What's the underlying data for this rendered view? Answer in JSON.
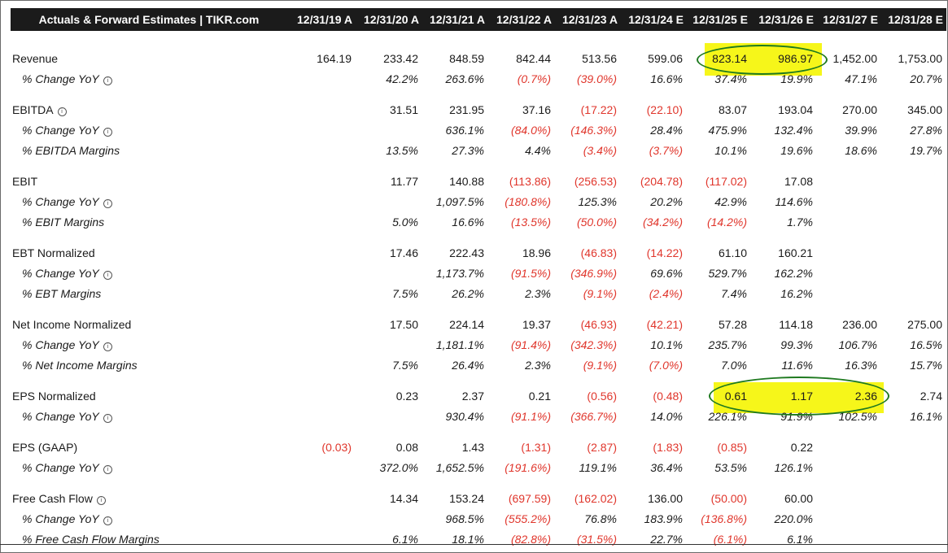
{
  "header": {
    "title": "Actuals & Forward Estimates | TIKR.com",
    "columns": [
      "12/31/19 A",
      "12/31/20 A",
      "12/31/21 A",
      "12/31/22 A",
      "12/31/23 A",
      "12/31/24 E",
      "12/31/25 E",
      "12/31/26 E",
      "12/31/27 E",
      "12/31/28 E"
    ]
  },
  "rows": [
    {
      "label": "Revenue",
      "sub": false,
      "info": false,
      "values": [
        "164.19",
        "233.42",
        "848.59",
        "842.44",
        "513.56",
        "599.06",
        "823.14",
        "986.97",
        "1,452.00",
        "1,753.00"
      ]
    },
    {
      "label": "% Change YoY",
      "sub": true,
      "info": true,
      "values": [
        "",
        "42.2%",
        "263.6%",
        "(0.7%)",
        "(39.0%)",
        "16.6%",
        "37.4%",
        "19.9%",
        "47.1%",
        "20.7%"
      ]
    },
    {
      "label": "EBITDA",
      "sub": false,
      "info": true,
      "values": [
        "",
        "31.51",
        "231.95",
        "37.16",
        "(17.22)",
        "(22.10)",
        "83.07",
        "193.04",
        "270.00",
        "345.00"
      ]
    },
    {
      "label": "% Change YoY",
      "sub": true,
      "info": true,
      "values": [
        "",
        "",
        "636.1%",
        "(84.0%)",
        "(146.3%)",
        "28.4%",
        "475.9%",
        "132.4%",
        "39.9%",
        "27.8%"
      ]
    },
    {
      "label": "% EBITDA Margins",
      "sub": true,
      "info": false,
      "values": [
        "",
        "13.5%",
        "27.3%",
        "4.4%",
        "(3.4%)",
        "(3.7%)",
        "10.1%",
        "19.6%",
        "18.6%",
        "19.7%"
      ]
    },
    {
      "label": "EBIT",
      "sub": false,
      "info": false,
      "values": [
        "",
        "11.77",
        "140.88",
        "(113.86)",
        "(256.53)",
        "(204.78)",
        "(117.02)",
        "17.08",
        "",
        ""
      ]
    },
    {
      "label": "% Change YoY",
      "sub": true,
      "info": true,
      "values": [
        "",
        "",
        "1,097.5%",
        "(180.8%)",
        "125.3%",
        "20.2%",
        "42.9%",
        "114.6%",
        "",
        ""
      ]
    },
    {
      "label": "% EBIT Margins",
      "sub": true,
      "info": false,
      "values": [
        "",
        "5.0%",
        "16.6%",
        "(13.5%)",
        "(50.0%)",
        "(34.2%)",
        "(14.2%)",
        "1.7%",
        "",
        ""
      ]
    },
    {
      "label": "EBT Normalized",
      "sub": false,
      "info": false,
      "values": [
        "",
        "17.46",
        "222.43",
        "18.96",
        "(46.83)",
        "(14.22)",
        "61.10",
        "160.21",
        "",
        ""
      ]
    },
    {
      "label": "% Change YoY",
      "sub": true,
      "info": true,
      "values": [
        "",
        "",
        "1,173.7%",
        "(91.5%)",
        "(346.9%)",
        "69.6%",
        "529.7%",
        "162.2%",
        "",
        ""
      ]
    },
    {
      "label": "% EBT Margins",
      "sub": true,
      "info": false,
      "values": [
        "",
        "7.5%",
        "26.2%",
        "2.3%",
        "(9.1%)",
        "(2.4%)",
        "7.4%",
        "16.2%",
        "",
        ""
      ]
    },
    {
      "label": "Net Income Normalized",
      "sub": false,
      "info": false,
      "values": [
        "",
        "17.50",
        "224.14",
        "19.37",
        "(46.93)",
        "(42.21)",
        "57.28",
        "114.18",
        "236.00",
        "275.00"
      ]
    },
    {
      "label": "% Change YoY",
      "sub": true,
      "info": true,
      "values": [
        "",
        "",
        "1,181.1%",
        "(91.4%)",
        "(342.3%)",
        "10.1%",
        "235.7%",
        "99.3%",
        "106.7%",
        "16.5%"
      ]
    },
    {
      "label": "% Net Income Margins",
      "sub": true,
      "info": false,
      "values": [
        "",
        "7.5%",
        "26.4%",
        "2.3%",
        "(9.1%)",
        "(7.0%)",
        "7.0%",
        "11.6%",
        "16.3%",
        "15.7%"
      ]
    },
    {
      "label": "EPS Normalized",
      "sub": false,
      "info": false,
      "values": [
        "",
        "0.23",
        "2.37",
        "0.21",
        "(0.56)",
        "(0.48)",
        "0.61",
        "1.17",
        "2.36",
        "2.74"
      ]
    },
    {
      "label": "% Change YoY",
      "sub": true,
      "info": true,
      "values": [
        "",
        "",
        "930.4%",
        "(91.1%)",
        "(366.7%)",
        "14.0%",
        "226.1%",
        "91.9%",
        "102.5%",
        "16.1%"
      ]
    },
    {
      "label": "EPS (GAAP)",
      "sub": false,
      "info": false,
      "values": [
        "(0.03)",
        "0.08",
        "1.43",
        "(1.31)",
        "(2.87)",
        "(1.83)",
        "(0.85)",
        "0.22",
        "",
        ""
      ]
    },
    {
      "label": "% Change YoY",
      "sub": true,
      "info": true,
      "values": [
        "",
        "372.0%",
        "1,652.5%",
        "(191.6%)",
        "119.1%",
        "36.4%",
        "53.5%",
        "126.1%",
        "",
        ""
      ]
    },
    {
      "label": "Free Cash Flow",
      "sub": false,
      "info": true,
      "values": [
        "",
        "14.34",
        "153.24",
        "(697.59)",
        "(162.02)",
        "136.00",
        "(50.00)",
        "60.00",
        "",
        ""
      ]
    },
    {
      "label": "% Change YoY",
      "sub": true,
      "info": true,
      "values": [
        "",
        "",
        "968.5%",
        "(555.2%)",
        "76.8%",
        "183.9%",
        "(136.8%)",
        "220.0%",
        "",
        ""
      ]
    },
    {
      "label": "% Free Cash Flow Margins",
      "sub": true,
      "info": false,
      "values": [
        "",
        "6.1%",
        "18.1%",
        "(82.8%)",
        "(31.5%)",
        "22.7%",
        "(6.1%)",
        "6.1%",
        "",
        ""
      ]
    }
  ],
  "colors": {
    "header_bg": "#1b1b1b",
    "negative": "#e0362c",
    "highlight": "#f6f61a",
    "circle": "#1f7a20"
  },
  "info_icon_glyph": "i"
}
